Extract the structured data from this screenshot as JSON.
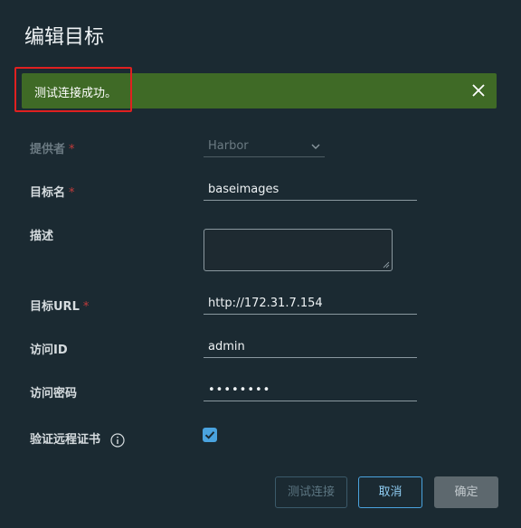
{
  "dialog": {
    "title": "编辑目标"
  },
  "alert": {
    "message": "测试连接成功。",
    "color": "#3f6a26"
  },
  "form": {
    "provider": {
      "label": "提供者",
      "required_mark": "*",
      "value": "Harbor"
    },
    "target_name": {
      "label": "目标名",
      "required_mark": "*",
      "value": "baseimages"
    },
    "description": {
      "label": "描述",
      "value": ""
    },
    "target_url": {
      "label": "目标URL",
      "required_mark": "*",
      "value": "http://172.31.7.154"
    },
    "access_id": {
      "label": "访问ID",
      "value": "admin"
    },
    "access_secret": {
      "label": "访问密码",
      "value": "••••••••"
    },
    "verify_cert": {
      "label": "验证远程证书",
      "checked": true
    }
  },
  "buttons": {
    "test": "测试连接",
    "cancel": "取消",
    "ok": "确定"
  },
  "colors": {
    "background": "#1b2a32",
    "accent": "#4aa3df",
    "required": "#c23b3b",
    "highlight": "#e02020"
  }
}
